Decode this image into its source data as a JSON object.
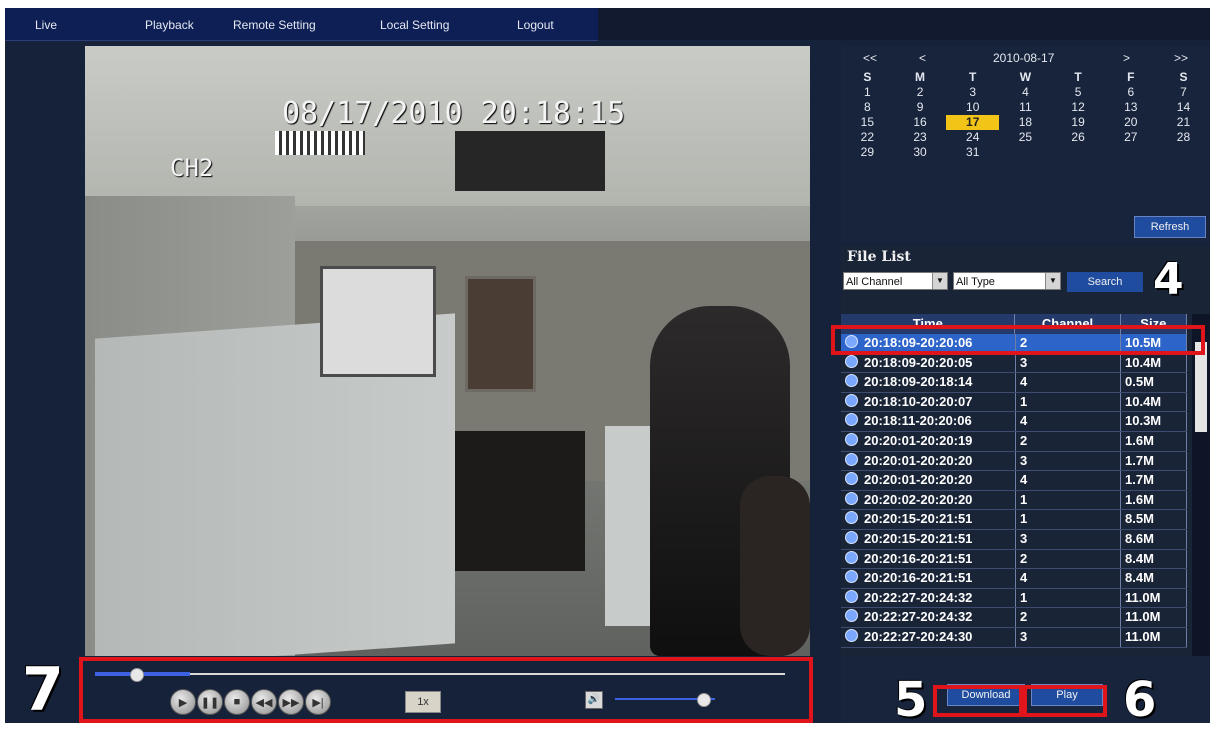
{
  "nav": {
    "live": "Live",
    "playback": "Playback",
    "remote_setting": "Remote Setting",
    "local_setting": "Local Setting",
    "logout": "Logout"
  },
  "video": {
    "timestamp": "08/17/2010 20:18:15",
    "channel": "CH2"
  },
  "controls": {
    "speed": "1x",
    "seek_progress": 0.06,
    "volume_level": 0.88
  },
  "calendar": {
    "prev_year": "<<",
    "prev_month": "<",
    "current": "2010-08-17",
    "next_month": ">",
    "next_year": ">>",
    "weekdays": [
      "S",
      "M",
      "T",
      "W",
      "T",
      "F",
      "S"
    ],
    "weeks": [
      [
        "1",
        "2",
        "3",
        "4",
        "5",
        "6",
        "7"
      ],
      [
        "8",
        "9",
        "10",
        "11",
        "12",
        "13",
        "14"
      ],
      [
        "15",
        "16",
        "17",
        "18",
        "19",
        "20",
        "21"
      ],
      [
        "22",
        "23",
        "24",
        "25",
        "26",
        "27",
        "28"
      ],
      [
        "29",
        "30",
        "31",
        "",
        "",
        "",
        ""
      ]
    ],
    "selected_day": "17",
    "refresh": "Refresh"
  },
  "file_list": {
    "title": "File List",
    "channel_select": "All Channel",
    "type_select": "All Type",
    "search": "Search",
    "columns": [
      "Time",
      "Channel",
      "Size"
    ],
    "rows": [
      {
        "time": "20:18:09-20:20:06",
        "channel": "2",
        "size": "10.5M"
      },
      {
        "time": "20:18:09-20:20:05",
        "channel": "3",
        "size": "10.4M"
      },
      {
        "time": "20:18:09-20:18:14",
        "channel": "4",
        "size": "0.5M"
      },
      {
        "time": "20:18:10-20:20:07",
        "channel": "1",
        "size": "10.4M"
      },
      {
        "time": "20:18:11-20:20:06",
        "channel": "4",
        "size": "10.3M"
      },
      {
        "time": "20:20:01-20:20:19",
        "channel": "2",
        "size": "1.6M"
      },
      {
        "time": "20:20:01-20:20:20",
        "channel": "3",
        "size": "1.7M"
      },
      {
        "time": "20:20:01-20:20:20",
        "channel": "4",
        "size": "1.7M"
      },
      {
        "time": "20:20:02-20:20:20",
        "channel": "1",
        "size": "1.6M"
      },
      {
        "time": "20:20:15-20:21:51",
        "channel": "1",
        "size": "8.5M"
      },
      {
        "time": "20:20:15-20:21:51",
        "channel": "3",
        "size": "8.6M"
      },
      {
        "time": "20:20:16-20:21:51",
        "channel": "2",
        "size": "8.4M"
      },
      {
        "time": "20:20:16-20:21:51",
        "channel": "4",
        "size": "8.4M"
      },
      {
        "time": "20:22:27-20:24:32",
        "channel": "1",
        "size": "11.0M"
      },
      {
        "time": "20:22:27-20:24:32",
        "channel": "2",
        "size": "11.0M"
      },
      {
        "time": "20:22:27-20:24:30",
        "channel": "3",
        "size": "11.0M"
      }
    ]
  },
  "actions": {
    "download": "Download",
    "play": "Play"
  },
  "callouts": {
    "four": "4",
    "five": "5",
    "six": "6",
    "seven": "7"
  },
  "colors": {
    "highlight": "#e0151b",
    "selected_row": "#2d64c9",
    "calendar_selected": "#f2c418"
  }
}
